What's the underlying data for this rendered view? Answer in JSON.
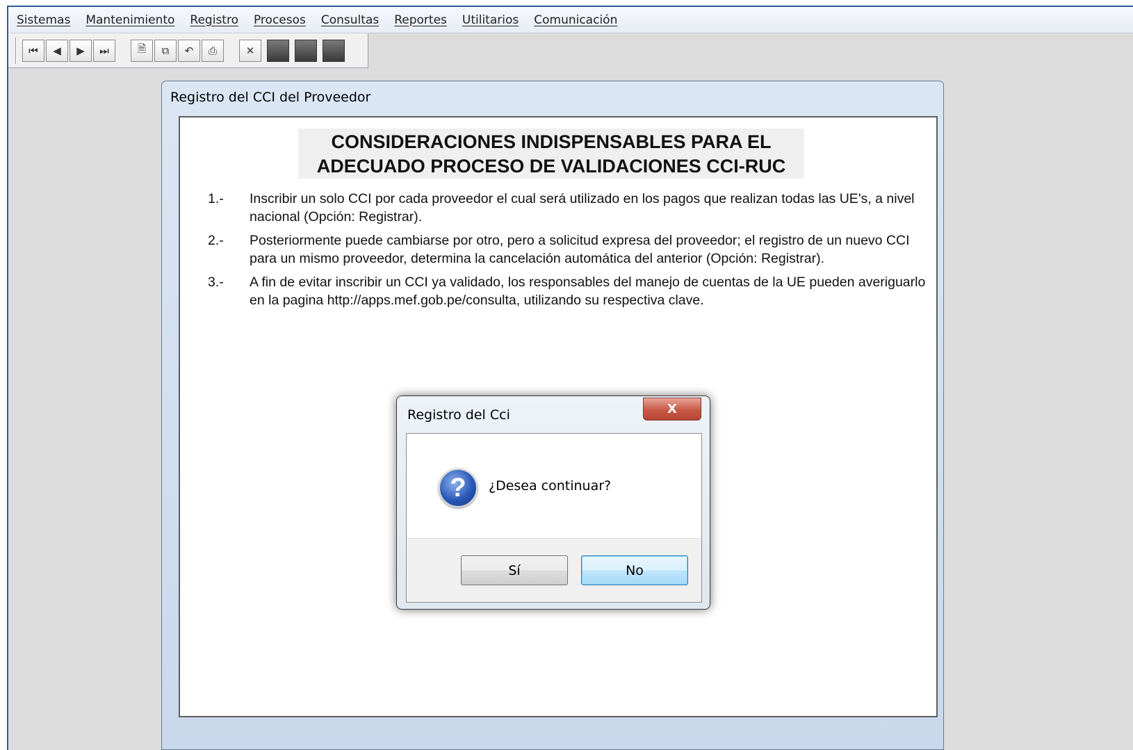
{
  "menubar": {
    "items": [
      "Sistemas",
      "Mantenimiento",
      "Registro",
      "Procesos",
      "Consultas",
      "Reportes",
      "Utilitarios",
      "Comunicación"
    ]
  },
  "toolbar": {
    "nav": [
      "first-record-icon",
      "previous-record-icon",
      "next-record-icon",
      "last-record-icon"
    ],
    "edit": [
      "new-document-icon",
      "copy-icon",
      "undo-icon",
      "print-icon"
    ],
    "other": [
      "delete-icon",
      "keyboard-icon",
      "stop-icon",
      "exit-icon"
    ]
  },
  "window": {
    "title": "Registro del CCI del Proveedor"
  },
  "document": {
    "heading_line1": "CONSIDERACIONES INDISPENSABLES PARA EL",
    "heading_line2": "ADECUADO PROCESO DE VALIDACIONES CCI-RUC",
    "items": [
      {
        "num": "1.-",
        "text": "Inscribir un solo CCI por cada proveedor el cual será utilizado en los pagos que realizan todas las UE's, a nivel nacional (Opción: Registrar)."
      },
      {
        "num": "2.-",
        "text": "Posteriormente puede cambiarse por otro, pero a solicitud expresa del proveedor; el registro de un nuevo CCI para un mismo proveedor, determina la cancelación automática del anterior (Opción: Registrar)."
      },
      {
        "num": "3.-",
        "text": "A fin de evitar inscribir un CCI ya validado, los responsables del manejo de cuentas de la UE pueden averiguarlo en la pagina http://apps.mef.gob.pe/consulta, utilizando su respectiva clave."
      }
    ]
  },
  "dialog": {
    "title": "Registro del Cci",
    "close_glyph": "X",
    "icon": "question-icon",
    "icon_glyph": "?",
    "message": "¿Desea continuar?",
    "yes_label": "Sí",
    "no_label": "No"
  }
}
